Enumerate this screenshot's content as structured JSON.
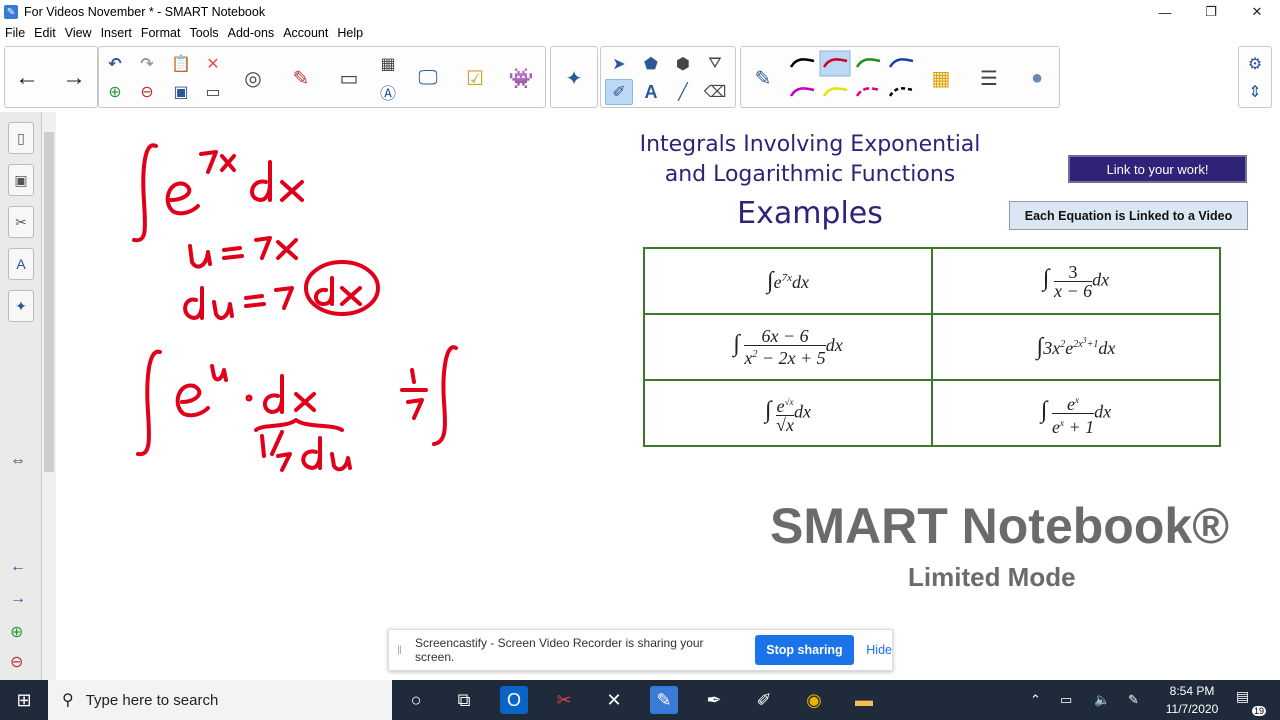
{
  "window": {
    "title": "For Videos November * - SMART Notebook",
    "controls": {
      "minimize": "—",
      "restore": "❐",
      "close": "✕"
    }
  },
  "menu": [
    "File",
    "Edit",
    "View",
    "Insert",
    "Format",
    "Tools",
    "Add-ons",
    "Account",
    "Help"
  ],
  "toolbar": {
    "back": "←",
    "forward": "→",
    "undo": "↶",
    "redo": "↷",
    "pen_colors": [
      "#000000",
      "#d0021b",
      "#1e8e1e",
      "#1a3fa0",
      "#c000c0",
      "#e5e500",
      "#e0007a",
      "#000000"
    ],
    "selected_pen": 1
  },
  "canvas": {
    "heading_line1": "Integrals Involving Exponential",
    "heading_line2": "and Logarithmic Functions",
    "heading_examples": "Examples",
    "link_button": "Link to your work!",
    "each_equation": "Each Equation is Linked to a Video",
    "handwriting_color": "#e0001a",
    "watermark_title": "SMART Notebook®",
    "watermark_sub": "Limited Mode"
  },
  "share_banner": {
    "message": "Screencastify - Screen Video Recorder is sharing your screen.",
    "stop": "Stop sharing",
    "hide": "Hide"
  },
  "taskbar": {
    "search_placeholder": "Type here to search",
    "time": "8:54 PM",
    "date": "11/7/2020",
    "notifications": "19"
  }
}
